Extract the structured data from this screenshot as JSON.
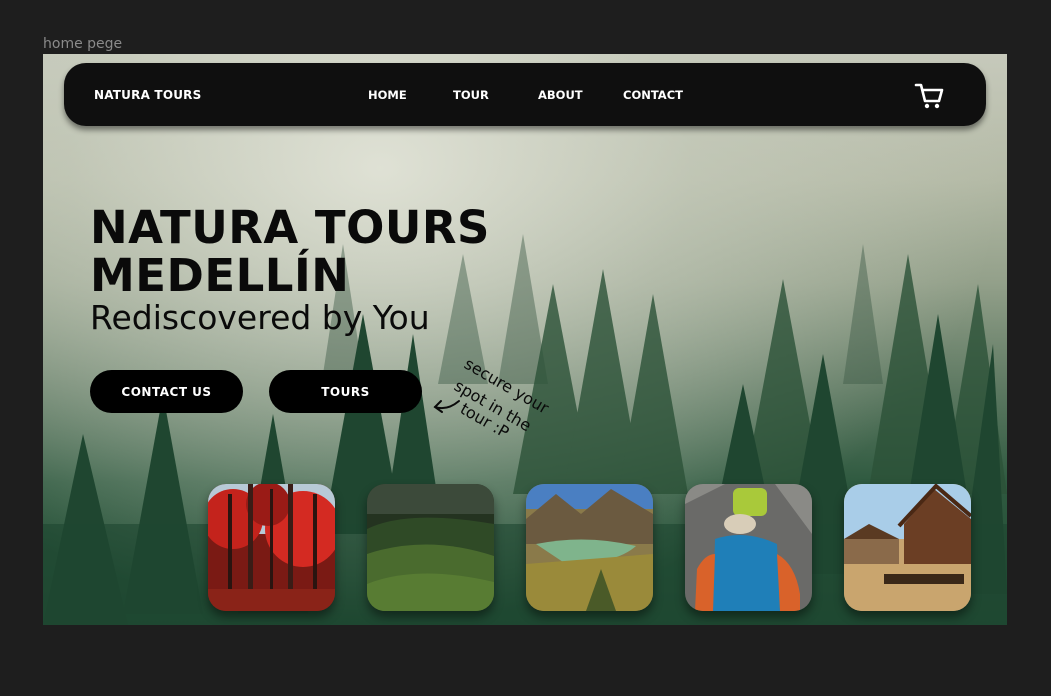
{
  "frame_label": "home pege",
  "nav": {
    "brand": "NATURA TOURS",
    "links": [
      {
        "label": "HOME"
      },
      {
        "label": "TOUR"
      },
      {
        "label": "ABOUT"
      },
      {
        "label": "CONTACT"
      }
    ],
    "cart_icon": "shopping-cart-icon"
  },
  "hero": {
    "title_line1": "NATURA TOURS",
    "title_line2": "MEDELLÍN",
    "subtitle": "Rediscovered by You"
  },
  "buttons": {
    "contact": "CONTACT US",
    "tours": "TOURS"
  },
  "note": {
    "lines": [
      "secure your",
      "spot in the",
      "tour :P"
    ]
  },
  "gallery": [
    {
      "name": "red-autumn-forest-photo"
    },
    {
      "name": "green-hills-photo"
    },
    {
      "name": "mountain-lake-photo"
    },
    {
      "name": "hiker-backpack-photo"
    },
    {
      "name": "floating-market-photo"
    }
  ],
  "colors": {
    "canvas_bg": "#1e1e1e",
    "navbar_bg": "#0f0f0f",
    "button_bg": "#000000",
    "text_dark": "#0a0a0a"
  }
}
